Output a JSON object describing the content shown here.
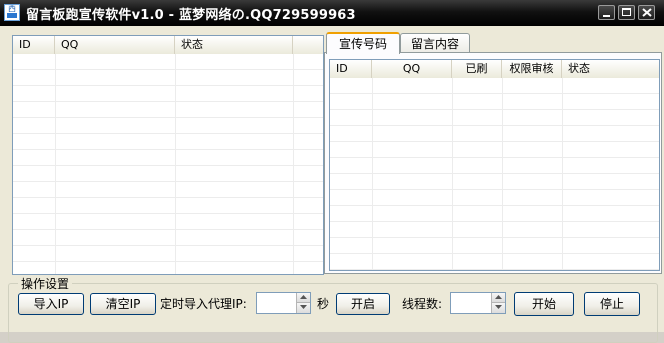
{
  "window": {
    "title": "留言板跑宣传软件v1.0 - 蓝梦网络の.QQ729599963",
    "icon_text": "西"
  },
  "left_list": {
    "columns": [
      "ID",
      "QQ",
      "状态"
    ]
  },
  "tabs": [
    {
      "label": "宣传号码",
      "selected": true
    },
    {
      "label": "留言内容",
      "selected": false
    }
  ],
  "right_list": {
    "columns": [
      "ID",
      "QQ",
      "已刷",
      "权限审核",
      "状态"
    ]
  },
  "operation": {
    "group_label": "操作设置",
    "import_ip": "导入IP",
    "clear_ip": "清空IP",
    "timed_import_label": "定时导入代理IP:",
    "timed_import_value": "",
    "seconds_label": "秒",
    "open_button": "开启",
    "threads_label": "线程数:",
    "threads_value": "",
    "start_button": "开始",
    "stop_button": "停止"
  },
  "colors": {
    "titlebar": "#000000",
    "window_bg": "#ece9d8",
    "tab_highlight": "#f0a000",
    "list_border": "#7f9db9"
  }
}
